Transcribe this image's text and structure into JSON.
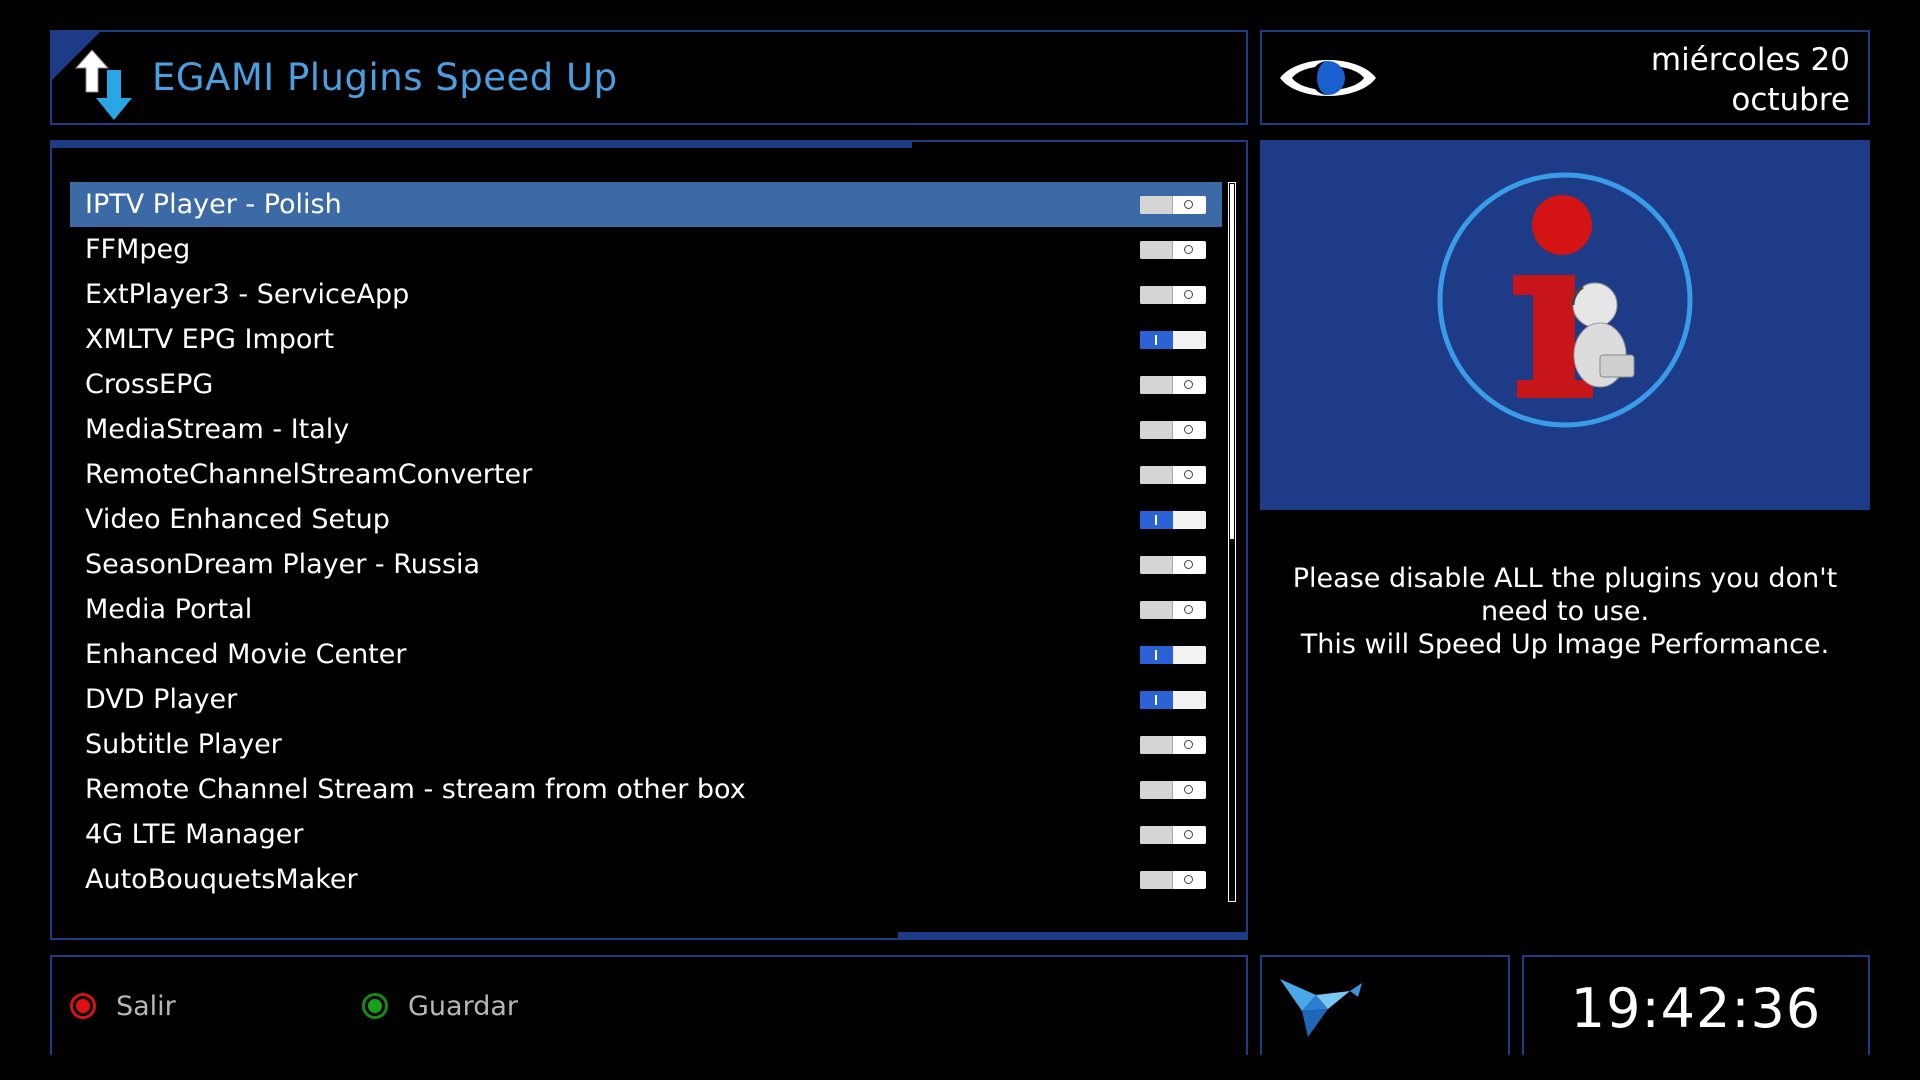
{
  "header": {
    "title": "EGAMI Plugins Speed Up"
  },
  "date": {
    "line1": "miércoles 20",
    "line2": "octubre"
  },
  "plugins": [
    {
      "name": "IPTV Player - Polish",
      "enabled": false,
      "selected": true
    },
    {
      "name": "FFMpeg",
      "enabled": false
    },
    {
      "name": "ExtPlayer3 - ServiceApp",
      "enabled": false
    },
    {
      "name": "XMLTV EPG Import",
      "enabled": true
    },
    {
      "name": "CrossEPG",
      "enabled": false
    },
    {
      "name": "MediaStream - Italy",
      "enabled": false
    },
    {
      "name": "RemoteChannelStreamConverter",
      "enabled": false
    },
    {
      "name": "Video Enhanced Setup",
      "enabled": true
    },
    {
      "name": "SeasonDream Player - Russia",
      "enabled": false
    },
    {
      "name": "Media Portal",
      "enabled": false
    },
    {
      "name": "Enhanced Movie Center",
      "enabled": true
    },
    {
      "name": "DVD Player",
      "enabled": true
    },
    {
      "name": "Subtitle Player",
      "enabled": false
    },
    {
      "name": "Remote Channel Stream - stream from other box",
      "enabled": false
    },
    {
      "name": "4G LTE Manager",
      "enabled": false
    },
    {
      "name": "AutoBouquetsMaker",
      "enabled": false
    }
  ],
  "info": {
    "line1": "Please disable ALL the plugins you don't need to use.",
    "line2": "This will Speed Up Image Performance."
  },
  "footer": {
    "exit_label": "Salir",
    "save_label": "Guardar"
  },
  "clock": "19:42:36",
  "colors": {
    "accent": "#1d3b86",
    "title": "#4a9fe0",
    "selection": "#3c6aa7",
    "toggle_on": "#2b63d6",
    "red": "#e01010",
    "green": "#18a018"
  }
}
